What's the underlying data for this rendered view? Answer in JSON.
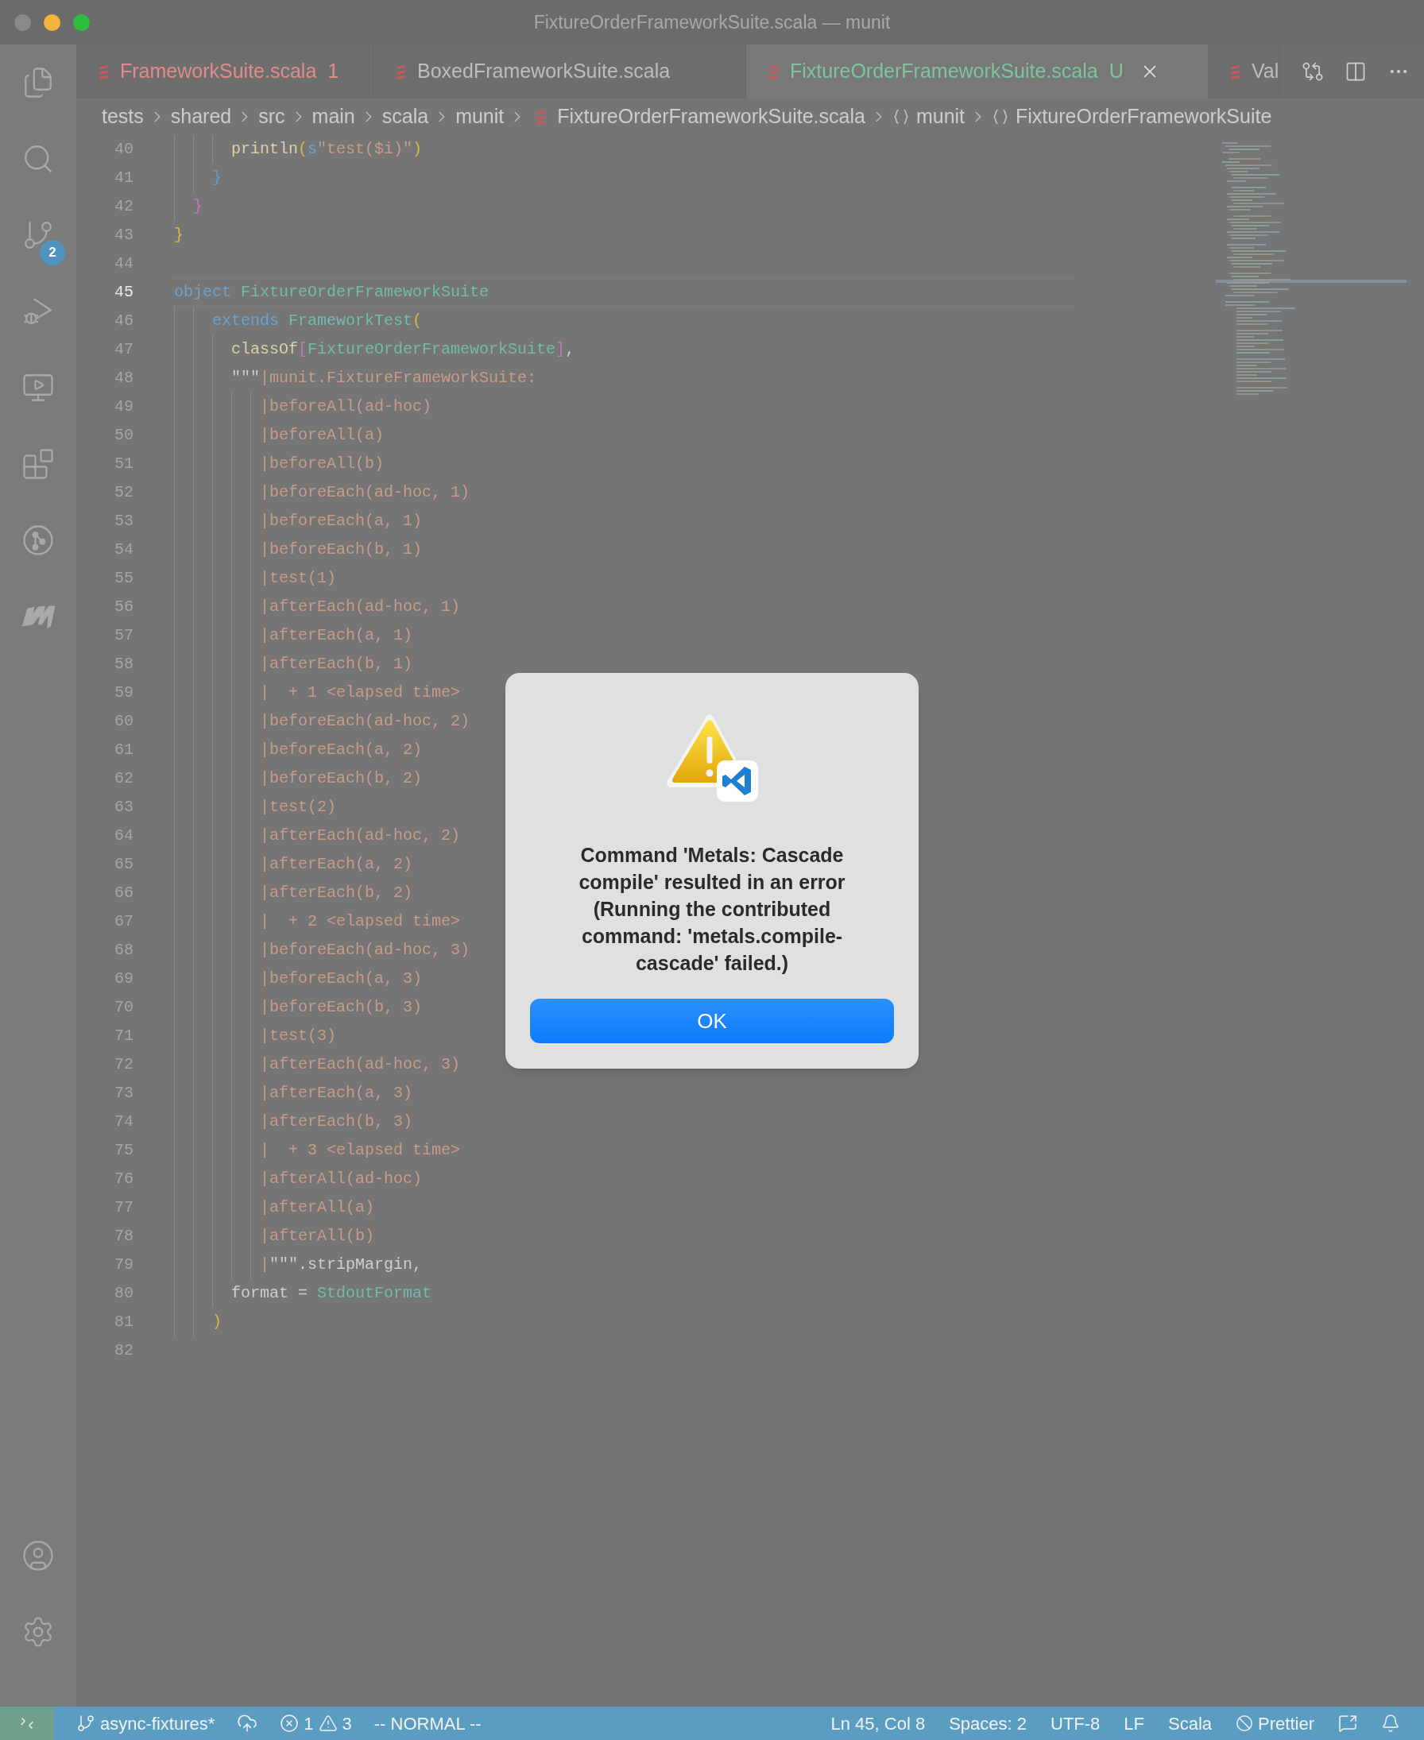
{
  "window": {
    "title": "FixtureOrderFrameworkSuite.scala — munit"
  },
  "activity_bar": {
    "top": [
      {
        "kind": "files"
      },
      {
        "kind": "search"
      },
      {
        "kind": "source-control",
        "badge": "2"
      },
      {
        "kind": "run-debug"
      },
      {
        "kind": "remote"
      },
      {
        "kind": "extensions"
      },
      {
        "kind": "git-graph"
      },
      {
        "kind": "metals"
      }
    ],
    "bottom": [
      {
        "kind": "account"
      },
      {
        "kind": "settings"
      }
    ]
  },
  "tabs": [
    {
      "label": "FrameworkSuite.scala",
      "decoration": "1",
      "color": "#e08c8c",
      "selected": false
    },
    {
      "label": "BoxedFrameworkSuite.scala",
      "color": "#bdbdbd",
      "selected": false
    },
    {
      "label": "FixtureOrderFrameworkSuite.scala",
      "decoration": "U",
      "color": "#7fc49c",
      "selected": true
    },
    {
      "label": "Val",
      "color": "#bdbdbd",
      "selected": false
    }
  ],
  "breadcrumbs": [
    {
      "label": "tests",
      "kind": "folder"
    },
    {
      "label": "shared",
      "kind": "folder"
    },
    {
      "label": "src",
      "kind": "folder"
    },
    {
      "label": "main",
      "kind": "folder"
    },
    {
      "label": "scala",
      "kind": "folder"
    },
    {
      "label": "munit",
      "kind": "folder"
    },
    {
      "label": "FixtureOrderFrameworkSuite.scala",
      "kind": "file"
    },
    {
      "label": "munit",
      "kind": "symbol"
    },
    {
      "label": "FixtureOrderFrameworkSuite",
      "kind": "symbol"
    }
  ],
  "editor": {
    "lines": [
      {
        "number": "40",
        "current": false,
        "tokens": [
          {
            "text": "      println",
            "kind": "function"
          },
          {
            "text": "(",
            "kind": "yellow"
          },
          {
            "text": "s",
            "kind": "keyword"
          },
          {
            "text": "\"test($i)\"",
            "kind": "string"
          },
          {
            "text": ")",
            "kind": "yellow"
          }
        ]
      },
      {
        "number": "41",
        "current": false,
        "tokens": [
          {
            "text": "    }",
            "kind": "blue"
          }
        ]
      },
      {
        "number": "42",
        "current": false,
        "tokens": [
          {
            "text": "  }",
            "kind": "pink"
          }
        ]
      },
      {
        "number": "43",
        "current": false,
        "tokens": [
          {
            "text": "}",
            "kind": "yellow"
          }
        ]
      },
      {
        "number": "44",
        "current": false
      },
      {
        "number": "45",
        "current": true,
        "tokens": [
          {
            "text": "object ",
            "kind": "keyword"
          },
          {
            "text": "FixtureOrderFrameworkSuite",
            "kind": "type"
          }
        ]
      },
      {
        "number": "46",
        "current": false,
        "tokens": [
          {
            "text": "    extends ",
            "kind": "keyword"
          },
          {
            "text": "FrameworkTest",
            "kind": "type"
          },
          {
            "text": "(",
            "kind": "yellow"
          }
        ]
      },
      {
        "number": "47",
        "current": false,
        "tokens": [
          {
            "text": "      classOf",
            "kind": "function"
          },
          {
            "text": "[",
            "kind": "pink"
          },
          {
            "text": "FixtureOrderFrameworkSuite",
            "kind": "type"
          },
          {
            "text": "]",
            "kind": "pink"
          },
          {
            "text": ",",
            "kind": "plain"
          }
        ]
      },
      {
        "number": "48",
        "current": false,
        "tokens": [
          {
            "text": "      \"\"\"",
            "kind": "plain"
          },
          {
            "text": "|munit.FixtureFrameworkSuite:",
            "kind": "string"
          }
        ]
      },
      {
        "number": "49",
        "current": false,
        "tokens": [
          {
            "text": "         |beforeAll(ad-hoc)",
            "kind": "string"
          }
        ]
      },
      {
        "number": "50",
        "current": false,
        "tokens": [
          {
            "text": "         |beforeAll(a)",
            "kind": "string"
          }
        ]
      },
      {
        "number": "51",
        "current": false,
        "tokens": [
          {
            "text": "         |beforeAll(b)",
            "kind": "string"
          }
        ]
      },
      {
        "number": "52",
        "current": false,
        "tokens": [
          {
            "text": "         |beforeEach(ad-hoc, 1)",
            "kind": "string"
          }
        ]
      },
      {
        "number": "53",
        "current": false,
        "tokens": [
          {
            "text": "         |beforeEach(a, 1)",
            "kind": "string"
          }
        ]
      },
      {
        "number": "54",
        "current": false,
        "tokens": [
          {
            "text": "         |beforeEach(b, 1)",
            "kind": "string"
          }
        ]
      },
      {
        "number": "55",
        "current": false,
        "tokens": [
          {
            "text": "         |test(1)",
            "kind": "string"
          }
        ]
      },
      {
        "number": "56",
        "current": false,
        "tokens": [
          {
            "text": "         |afterEach(ad-hoc, 1)",
            "kind": "string"
          }
        ]
      },
      {
        "number": "57",
        "current": false,
        "tokens": [
          {
            "text": "         |afterEach(a, 1)",
            "kind": "string"
          }
        ]
      },
      {
        "number": "58",
        "current": false,
        "tokens": [
          {
            "text": "         |afterEach(b, 1)",
            "kind": "string"
          }
        ]
      },
      {
        "number": "59",
        "current": false,
        "tokens": [
          {
            "text": "         |  + 1 <elapsed time>",
            "kind": "string"
          }
        ]
      },
      {
        "number": "60",
        "current": false,
        "tokens": [
          {
            "text": "         |beforeEach(ad-hoc, 2)",
            "kind": "string"
          }
        ]
      },
      {
        "number": "61",
        "current": false,
        "tokens": [
          {
            "text": "         |beforeEach(a, 2)",
            "kind": "string"
          }
        ]
      },
      {
        "number": "62",
        "current": false,
        "tokens": [
          {
            "text": "         |beforeEach(b, 2)",
            "kind": "string"
          }
        ]
      },
      {
        "number": "63",
        "current": false,
        "tokens": [
          {
            "text": "         |test(2)",
            "kind": "string"
          }
        ]
      },
      {
        "number": "64",
        "current": false,
        "tokens": [
          {
            "text": "         |afterEach(ad-hoc, 2)",
            "kind": "string"
          }
        ]
      },
      {
        "number": "65",
        "current": false,
        "tokens": [
          {
            "text": "         |afterEach(a, 2)",
            "kind": "string"
          }
        ]
      },
      {
        "number": "66",
        "current": false,
        "tokens": [
          {
            "text": "         |afterEach(b, 2)",
            "kind": "string"
          }
        ]
      },
      {
        "number": "67",
        "current": false,
        "tokens": [
          {
            "text": "         |  + 2 <elapsed time>",
            "kind": "string"
          }
        ]
      },
      {
        "number": "68",
        "current": false,
        "tokens": [
          {
            "text": "         |beforeEach(ad-hoc, 3)",
            "kind": "string"
          }
        ]
      },
      {
        "number": "69",
        "current": false,
        "tokens": [
          {
            "text": "         |beforeEach(a, 3)",
            "kind": "string"
          }
        ]
      },
      {
        "number": "70",
        "current": false,
        "tokens": [
          {
            "text": "         |beforeEach(b, 3)",
            "kind": "string"
          }
        ]
      },
      {
        "number": "71",
        "current": false,
        "tokens": [
          {
            "text": "         |test(3)",
            "kind": "string"
          }
        ]
      },
      {
        "number": "72",
        "current": false,
        "tokens": [
          {
            "text": "         |afterEach(ad-hoc, 3)",
            "kind": "string"
          }
        ]
      },
      {
        "number": "73",
        "current": false,
        "tokens": [
          {
            "text": "         |afterEach(a, 3)",
            "kind": "string"
          }
        ]
      },
      {
        "number": "74",
        "current": false,
        "tokens": [
          {
            "text": "         |afterEach(b, 3)",
            "kind": "string"
          }
        ]
      },
      {
        "number": "75",
        "current": false,
        "tokens": [
          {
            "text": "         |  + 3 <elapsed time>",
            "kind": "string"
          }
        ]
      },
      {
        "number": "76",
        "current": false,
        "tokens": [
          {
            "text": "         |afterAll(ad-hoc)",
            "kind": "string"
          }
        ]
      },
      {
        "number": "77",
        "current": false,
        "tokens": [
          {
            "text": "         |afterAll(a)",
            "kind": "string"
          }
        ]
      },
      {
        "number": "78",
        "current": false,
        "tokens": [
          {
            "text": "         |afterAll(b)",
            "kind": "string"
          }
        ]
      },
      {
        "number": "79",
        "current": false,
        "tokens": [
          {
            "text": "         |",
            "kind": "string"
          },
          {
            "text": "\"\"\".stripMargin,",
            "kind": "plain"
          }
        ]
      },
      {
        "number": "80",
        "current": false,
        "tokens": [
          {
            "text": "      format = ",
            "kind": "plain"
          },
          {
            "text": "StdoutFormat",
            "kind": "type"
          }
        ]
      },
      {
        "number": "81",
        "current": false,
        "tokens": [
          {
            "text": "    )",
            "kind": "yellow"
          }
        ]
      },
      {
        "number": "82",
        "current": false
      }
    ]
  },
  "dialog": {
    "message": "Command 'Metals: Cascade compile' resulted in an error (Running the contributed command: 'metals.compile-cascade' failed.)",
    "button": "OK"
  },
  "status_bar": {
    "left": [
      {
        "kind": "remote"
      },
      {
        "kind": "branch",
        "text": "async-fixtures*"
      },
      {
        "kind": "sync"
      },
      {
        "kind": "problems",
        "errors": "1",
        "warnings": "3"
      },
      {
        "kind": "text",
        "text": "-- NORMAL --"
      }
    ],
    "right": [
      {
        "kind": "text",
        "text": "Ln 45, Col 8"
      },
      {
        "kind": "text",
        "text": "Spaces: 2"
      },
      {
        "kind": "text",
        "text": "UTF-8"
      },
      {
        "kind": "text",
        "text": "LF"
      },
      {
        "kind": "text",
        "text": "Scala"
      },
      {
        "kind": "prettier",
        "text": "Prettier"
      },
      {
        "kind": "feedback"
      },
      {
        "kind": "bell"
      }
    ]
  }
}
